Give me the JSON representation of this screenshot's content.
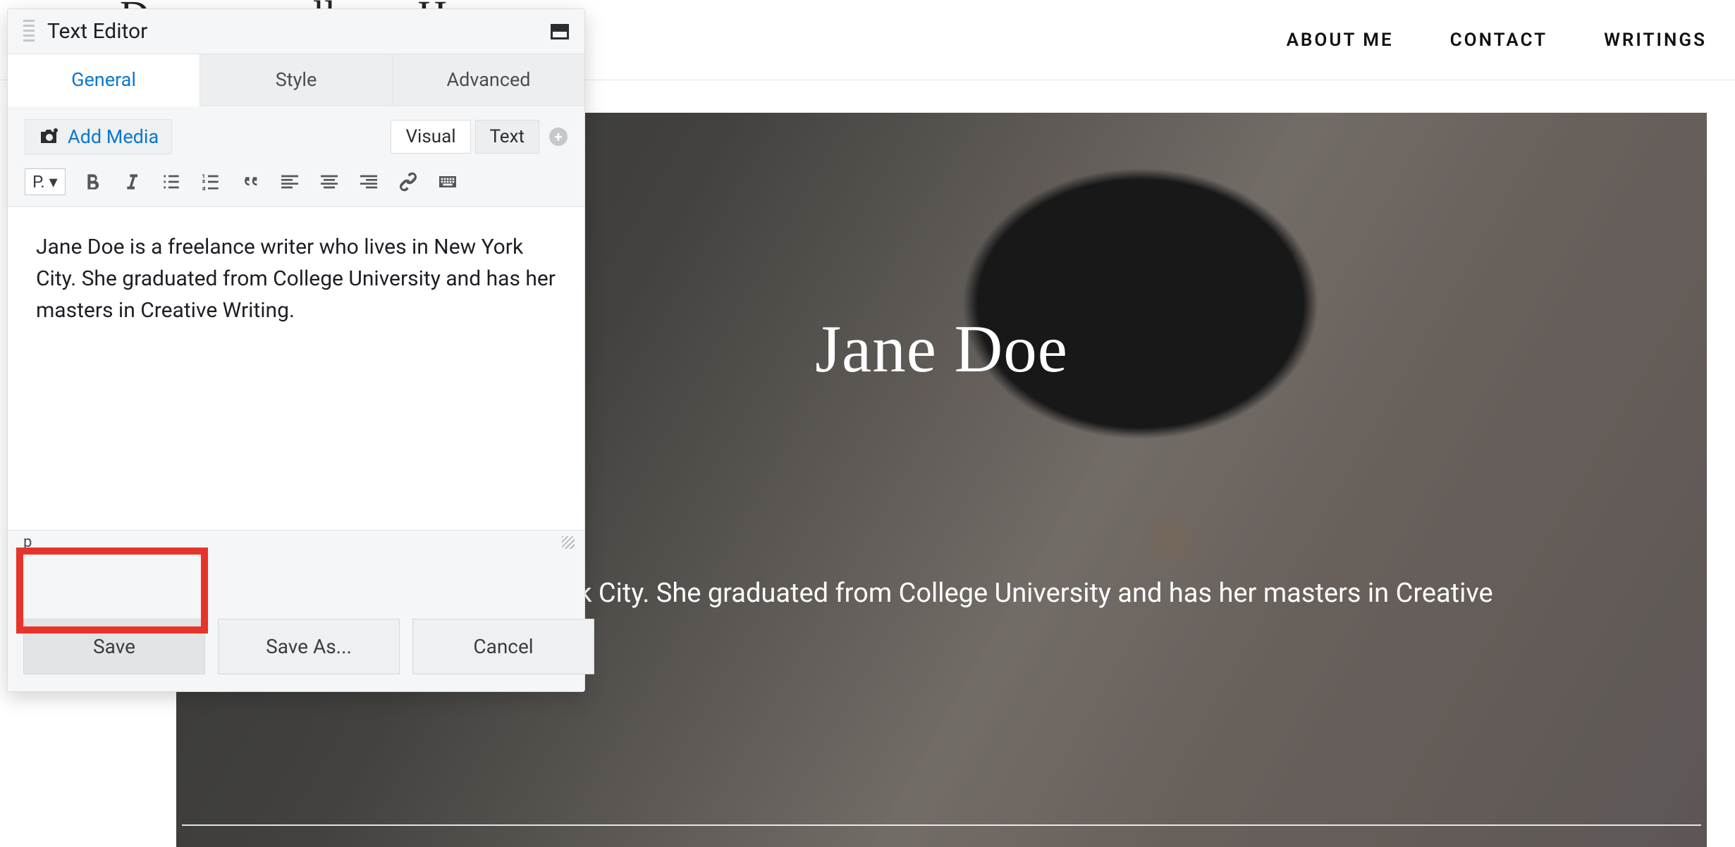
{
  "nav": {
    "brand_fragment": "D    ll  H",
    "items": [
      "ABOUT ME",
      "CONTACT",
      "WRITINGS"
    ]
  },
  "hero": {
    "title": "Jane Doe",
    "subtitle_visible": "lives in New York City. She graduated from College University and has her masters in Creative"
  },
  "panel": {
    "title": "Text Editor",
    "tabs": {
      "general": "General",
      "style": "Style",
      "advanced": "Advanced",
      "active": "general"
    },
    "add_media": "Add Media",
    "mode_tabs": {
      "visual": "Visual",
      "text": "Text",
      "active": "visual"
    },
    "paragraph_selector": "P.",
    "content": "Jane Doe is a freelance writer who lives in New York City. She graduated from College University and has her masters in Creative Writing.",
    "path": "p",
    "buttons": {
      "save": "Save",
      "save_as": "Save As...",
      "cancel": "Cancel"
    }
  },
  "colors": {
    "accent": "#0b78d0",
    "highlight": "#e7342a"
  }
}
